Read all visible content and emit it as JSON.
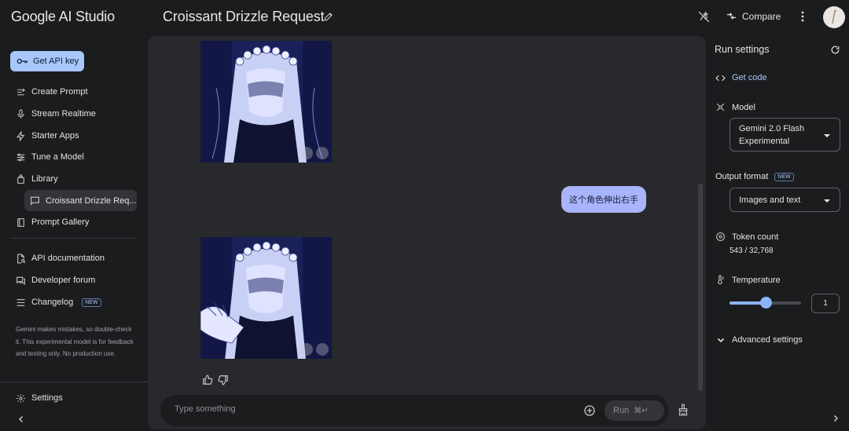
{
  "app": {
    "name": "Google AI Studio"
  },
  "header": {
    "title": "Croissant Drizzle Request",
    "compare_label": "Compare"
  },
  "sidebar": {
    "api_key_label": "Get API key",
    "items": [
      {
        "label": "Create Prompt",
        "icon": "create-prompt-icon"
      },
      {
        "label": "Stream Realtime",
        "icon": "microphone-icon"
      },
      {
        "label": "Starter Apps",
        "icon": "bolt-icon"
      },
      {
        "label": "Tune a Model",
        "icon": "tune-icon"
      },
      {
        "label": "Library",
        "icon": "library-icon"
      }
    ],
    "library_item": "Croissant Drizzle Req...",
    "prompt_gallery": "Prompt Gallery",
    "links": [
      {
        "label": "API documentation",
        "icon": "doc-search-icon"
      },
      {
        "label": "Developer forum",
        "icon": "forum-icon"
      },
      {
        "label": "Changelog",
        "icon": "changelog-icon",
        "badge": "NEW"
      }
    ],
    "disclaimer": "Gemini makes mistakes, so double-check it. This experimental model is for feedback and testing only. No production use.",
    "settings_label": "Settings"
  },
  "chat": {
    "user_message": "这个角色伸出右手",
    "prompt_placeholder": "Type something",
    "run_label": "Run",
    "run_shortcut": "⌘↵"
  },
  "run_settings": {
    "title": "Run settings",
    "get_code": "Get code",
    "model_label": "Model",
    "model_value": "Gemini 2.0 Flash Experimental",
    "output_format_label": "Output format",
    "output_format_badge": "NEW",
    "output_format_value": "Images and text",
    "token_count_label": "Token count",
    "token_count_value": "543 / 32,768",
    "temperature_label": "Temperature",
    "temperature_value": "1",
    "temperature_fraction": 0.5,
    "advanced_label": "Advanced settings"
  },
  "colors": {
    "accent": "#a8c7fa",
    "user_bubble": "#a8b4fb",
    "background": "#1b1c1e",
    "chat_panel": "#28292c"
  }
}
